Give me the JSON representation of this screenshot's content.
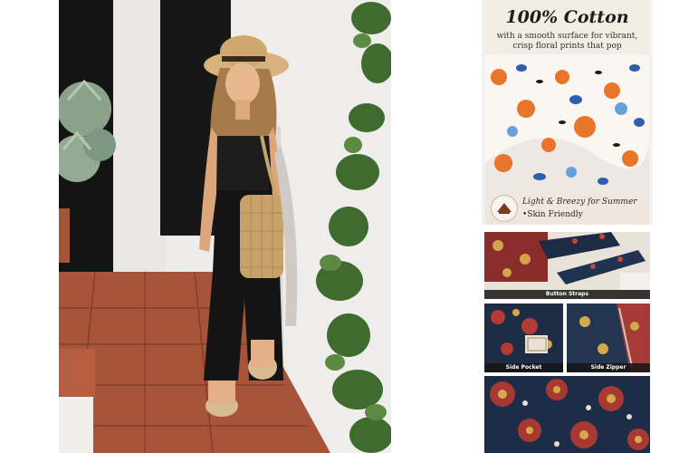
{
  "gallery": {
    "cotton_card": {
      "title": "100% Cotton",
      "subtitle_line1": "with a smooth surface for vibrant,",
      "subtitle_line2": "crisp floral prints that pop",
      "feature1": "Light & Breezy for Summer",
      "feature2": "•Skin Friendly"
    },
    "details": {
      "straps_caption": "Button Straps",
      "pocket_caption": "Side Pocket",
      "zipper_caption": "Side Zipper"
    }
  }
}
